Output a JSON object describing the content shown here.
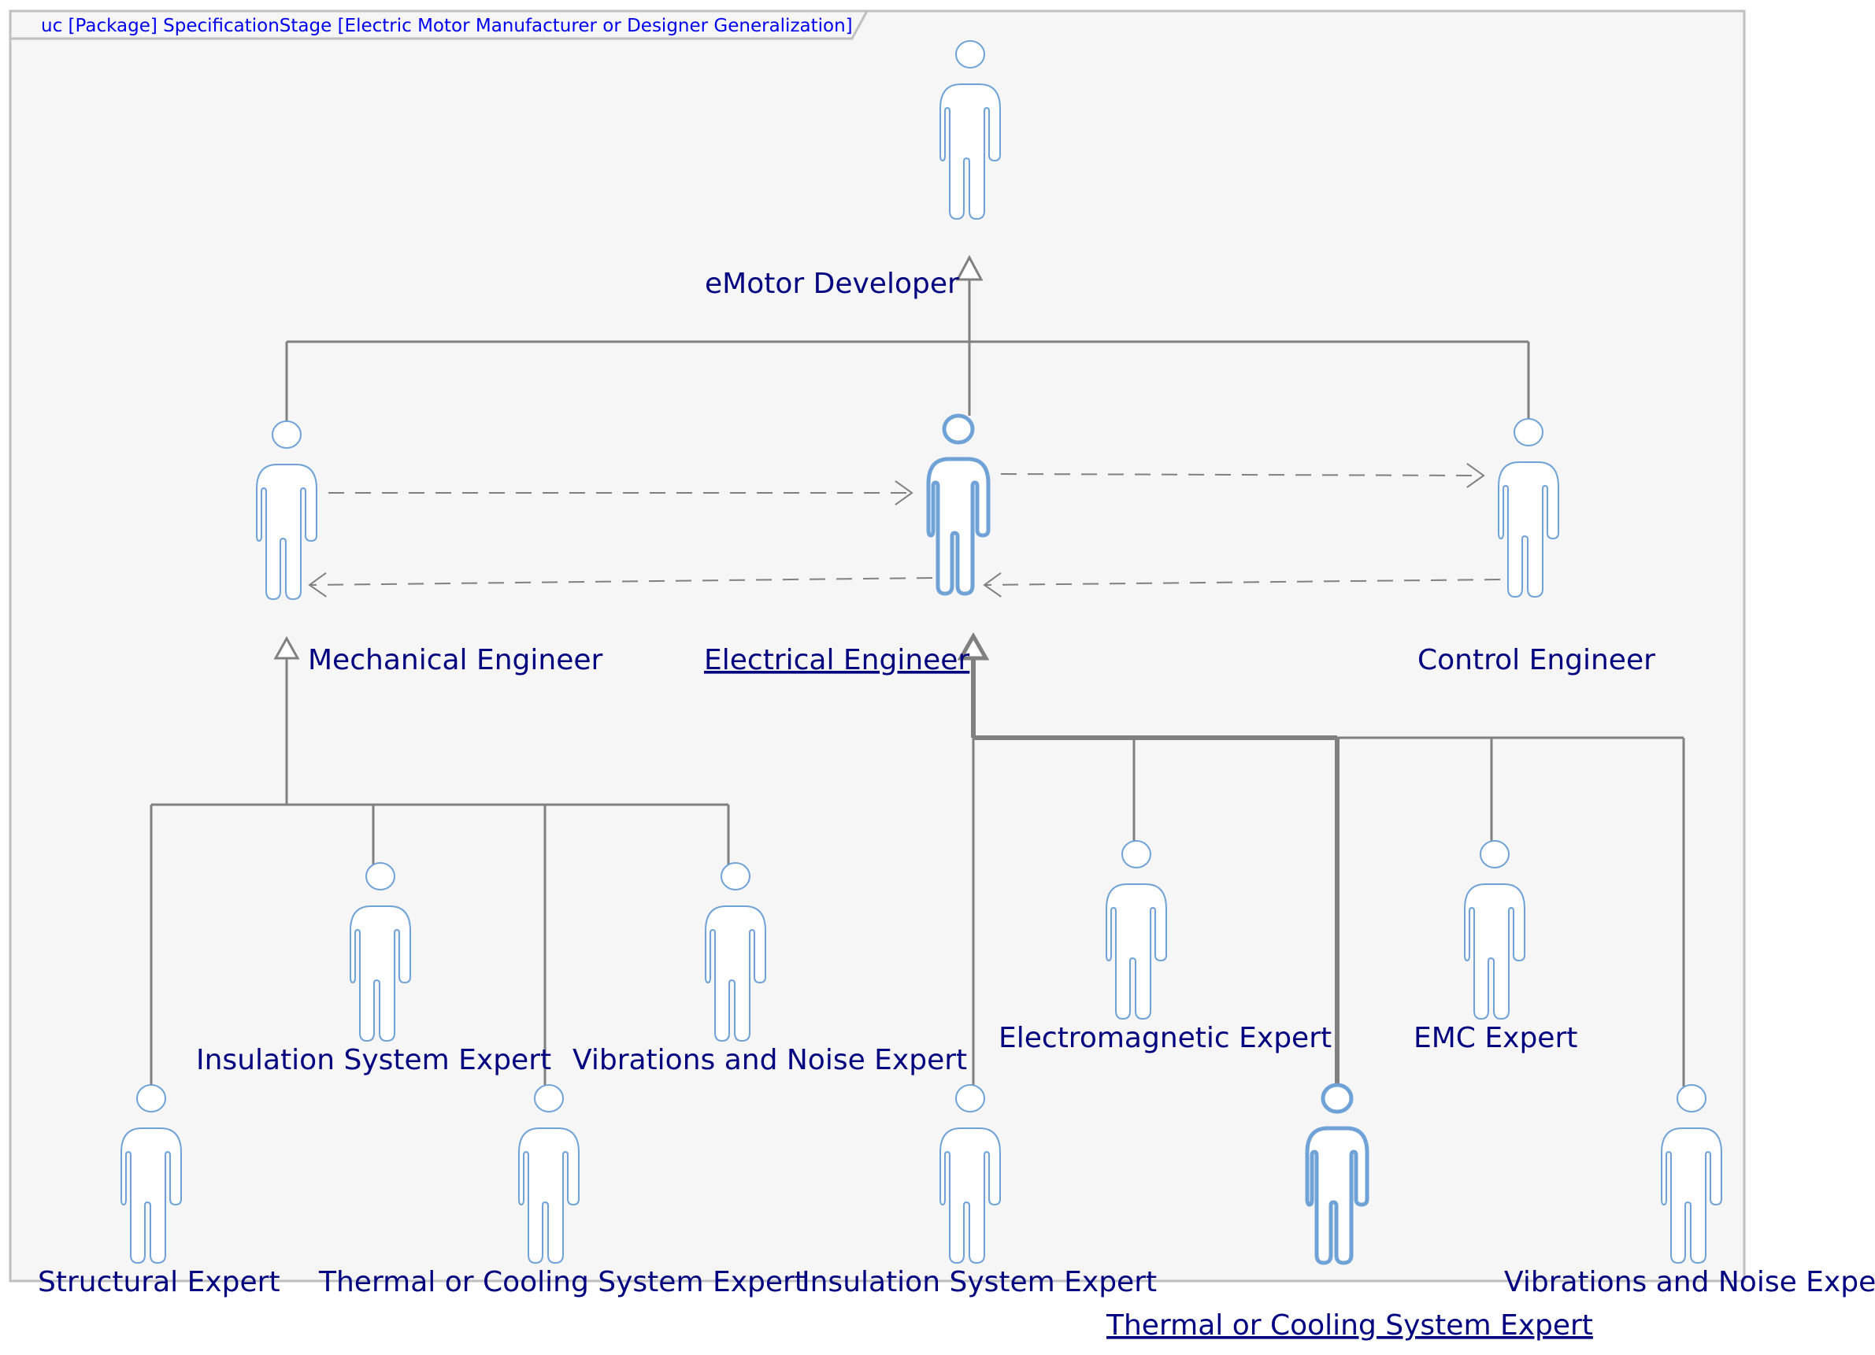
{
  "diagram": {
    "title": "uc [Package] SpecificationStage [Electric Motor Manufacturer or Designer Generalization]",
    "kind": "Use Case Diagram",
    "colors": {
      "frame_border": "#c0c0c0",
      "frame_fill": "#f6f6f6",
      "actor_stroke": "#6fa3d8",
      "line": "#808080",
      "label": "#000080",
      "title": "#0000ee"
    },
    "actors": [
      {
        "id": "emotor_developer",
        "name": "eMotor Developer",
        "highlighted": false
      },
      {
        "id": "mechanical_engineer",
        "name": "Mechanical Engineer",
        "highlighted": false
      },
      {
        "id": "electrical_engineer",
        "name": "Electrical Engineer",
        "highlighted": true
      },
      {
        "id": "control_engineer",
        "name": "Control Engineer",
        "highlighted": false
      },
      {
        "id": "mech_structural_expert",
        "name": "Structural Expert",
        "highlighted": false
      },
      {
        "id": "mech_insulation_system_expert",
        "name": "Insulation System Expert",
        "highlighted": false
      },
      {
        "id": "mech_thermal_cooling_expert",
        "name": "Thermal or Cooling System Expert",
        "highlighted": false
      },
      {
        "id": "mech_vibrations_noise_expert",
        "name": "Vibrations and Noise Expert",
        "highlighted": false
      },
      {
        "id": "elec_insulation_system_expert",
        "name": "Insulation System Expert",
        "highlighted": false
      },
      {
        "id": "elec_electromagnetic_expert",
        "name": "Electromagnetic Expert",
        "highlighted": false
      },
      {
        "id": "elec_thermal_cooling_expert",
        "name": "Thermal or Cooling System Expert",
        "highlighted": true
      },
      {
        "id": "elec_emc_expert",
        "name": "EMC Expert",
        "highlighted": false
      },
      {
        "id": "elec_vibrations_noise_expert",
        "name": "Vibrations and Noise Expert",
        "highlighted": false
      }
    ],
    "generalizations": [
      {
        "child": "mechanical_engineer",
        "parent": "emotor_developer"
      },
      {
        "child": "electrical_engineer",
        "parent": "emotor_developer"
      },
      {
        "child": "control_engineer",
        "parent": "emotor_developer"
      },
      {
        "child": "mech_structural_expert",
        "parent": "mechanical_engineer"
      },
      {
        "child": "mech_insulation_system_expert",
        "parent": "mechanical_engineer"
      },
      {
        "child": "mech_thermal_cooling_expert",
        "parent": "mechanical_engineer"
      },
      {
        "child": "mech_vibrations_noise_expert",
        "parent": "mechanical_engineer"
      },
      {
        "child": "elec_insulation_system_expert",
        "parent": "electrical_engineer"
      },
      {
        "child": "elec_electromagnetic_expert",
        "parent": "electrical_engineer"
      },
      {
        "child": "elec_thermal_cooling_expert",
        "parent": "electrical_engineer"
      },
      {
        "child": "elec_emc_expert",
        "parent": "electrical_engineer"
      },
      {
        "child": "elec_vibrations_noise_expert",
        "parent": "electrical_engineer"
      }
    ],
    "dependencies": [
      {
        "from": "mechanical_engineer",
        "to": "electrical_engineer"
      },
      {
        "from": "electrical_engineer",
        "to": "mechanical_engineer"
      },
      {
        "from": "electrical_engineer",
        "to": "control_engineer"
      },
      {
        "from": "control_engineer",
        "to": "electrical_engineer"
      }
    ]
  }
}
